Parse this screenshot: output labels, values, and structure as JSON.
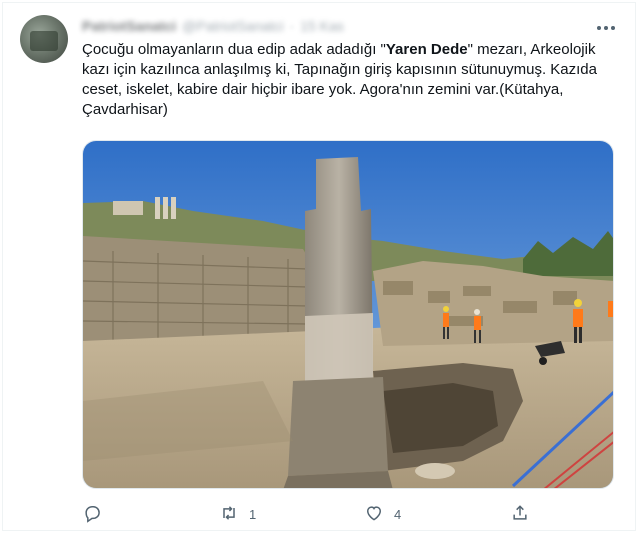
{
  "author": {
    "display_name": "PatriotSanatci",
    "handle": "@PatriotSanatci",
    "separator": "·",
    "time": "15 Kas"
  },
  "tweet": {
    "text_before": "Çocuğu olmayanların dua edip adak adadığı \"",
    "text_bold": "Yaren Dede",
    "text_after": "\" mezarı, Arkeolojik kazı için kazılınca anlaşılmış ki, Tapınağın giriş kapısının sütunuymuş. Kazıda ceset, iskelet, kabire dair hiçbir ibare yok. Agora'nın zemini var.(Kütahya, Çavdarhisar)"
  },
  "actions": {
    "reply_count": "",
    "retweet_count": "1",
    "like_count": "4",
    "share_count": ""
  },
  "icons": {
    "reply": "reply-icon",
    "retweet": "retweet-icon",
    "like": "heart-icon",
    "share": "share-icon",
    "more": "more-icon"
  },
  "colors": {
    "text": "#0f1419",
    "secondary": "#536471",
    "sky": "#3f7fd0"
  }
}
